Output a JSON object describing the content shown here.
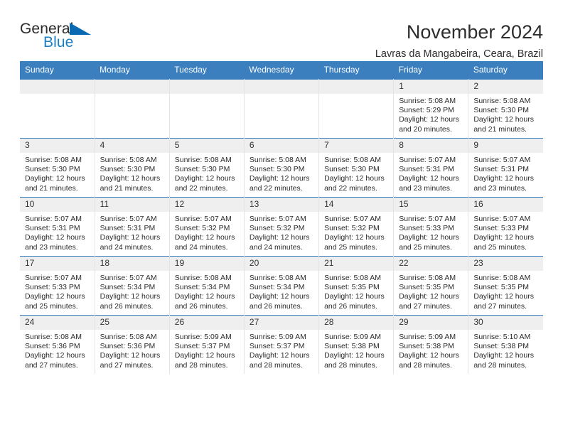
{
  "brand": {
    "name_part1": "General",
    "name_part2": "Blue",
    "accent_color": "#1b7fc4",
    "triangle_color": "#0a69b3"
  },
  "header": {
    "title": "November 2024",
    "subtitle": "Lavras da Mangabeira, Ceara, Brazil",
    "header_bg_color": "#3b7fbf",
    "daynum_bg_color": "#efefef"
  },
  "weekday_headers": [
    "Sunday",
    "Monday",
    "Tuesday",
    "Wednesday",
    "Thursday",
    "Friday",
    "Saturday"
  ],
  "labels": {
    "sunrise_prefix": "Sunrise:",
    "sunset_prefix": "Sunset:",
    "daylight_prefix": "Daylight:"
  },
  "weeks": [
    [
      {
        "day": "",
        "empty": true,
        "l1": "",
        "l2": "",
        "l3": "",
        "l4": ""
      },
      {
        "day": "",
        "empty": true,
        "l1": "",
        "l2": "",
        "l3": "",
        "l4": ""
      },
      {
        "day": "",
        "empty": true,
        "l1": "",
        "l2": "",
        "l3": "",
        "l4": ""
      },
      {
        "day": "",
        "empty": true,
        "l1": "",
        "l2": "",
        "l3": "",
        "l4": ""
      },
      {
        "day": "",
        "empty": true,
        "l1": "",
        "l2": "",
        "l3": "",
        "l4": ""
      },
      {
        "day": "1",
        "empty": false,
        "l1": "Sunrise: 5:08 AM",
        "l2": "Sunset: 5:29 PM",
        "l3": "Daylight: 12 hours",
        "l4": "and 20 minutes."
      },
      {
        "day": "2",
        "empty": false,
        "l1": "Sunrise: 5:08 AM",
        "l2": "Sunset: 5:30 PM",
        "l3": "Daylight: 12 hours",
        "l4": "and 21 minutes."
      }
    ],
    [
      {
        "day": "3",
        "empty": false,
        "l1": "Sunrise: 5:08 AM",
        "l2": "Sunset: 5:30 PM",
        "l3": "Daylight: 12 hours",
        "l4": "and 21 minutes."
      },
      {
        "day": "4",
        "empty": false,
        "l1": "Sunrise: 5:08 AM",
        "l2": "Sunset: 5:30 PM",
        "l3": "Daylight: 12 hours",
        "l4": "and 21 minutes."
      },
      {
        "day": "5",
        "empty": false,
        "l1": "Sunrise: 5:08 AM",
        "l2": "Sunset: 5:30 PM",
        "l3": "Daylight: 12 hours",
        "l4": "and 22 minutes."
      },
      {
        "day": "6",
        "empty": false,
        "l1": "Sunrise: 5:08 AM",
        "l2": "Sunset: 5:30 PM",
        "l3": "Daylight: 12 hours",
        "l4": "and 22 minutes."
      },
      {
        "day": "7",
        "empty": false,
        "l1": "Sunrise: 5:08 AM",
        "l2": "Sunset: 5:30 PM",
        "l3": "Daylight: 12 hours",
        "l4": "and 22 minutes."
      },
      {
        "day": "8",
        "empty": false,
        "l1": "Sunrise: 5:07 AM",
        "l2": "Sunset: 5:31 PM",
        "l3": "Daylight: 12 hours",
        "l4": "and 23 minutes."
      },
      {
        "day": "9",
        "empty": false,
        "l1": "Sunrise: 5:07 AM",
        "l2": "Sunset: 5:31 PM",
        "l3": "Daylight: 12 hours",
        "l4": "and 23 minutes."
      }
    ],
    [
      {
        "day": "10",
        "empty": false,
        "l1": "Sunrise: 5:07 AM",
        "l2": "Sunset: 5:31 PM",
        "l3": "Daylight: 12 hours",
        "l4": "and 23 minutes."
      },
      {
        "day": "11",
        "empty": false,
        "l1": "Sunrise: 5:07 AM",
        "l2": "Sunset: 5:31 PM",
        "l3": "Daylight: 12 hours",
        "l4": "and 24 minutes."
      },
      {
        "day": "12",
        "empty": false,
        "l1": "Sunrise: 5:07 AM",
        "l2": "Sunset: 5:32 PM",
        "l3": "Daylight: 12 hours",
        "l4": "and 24 minutes."
      },
      {
        "day": "13",
        "empty": false,
        "l1": "Sunrise: 5:07 AM",
        "l2": "Sunset: 5:32 PM",
        "l3": "Daylight: 12 hours",
        "l4": "and 24 minutes."
      },
      {
        "day": "14",
        "empty": false,
        "l1": "Sunrise: 5:07 AM",
        "l2": "Sunset: 5:32 PM",
        "l3": "Daylight: 12 hours",
        "l4": "and 25 minutes."
      },
      {
        "day": "15",
        "empty": false,
        "l1": "Sunrise: 5:07 AM",
        "l2": "Sunset: 5:33 PM",
        "l3": "Daylight: 12 hours",
        "l4": "and 25 minutes."
      },
      {
        "day": "16",
        "empty": false,
        "l1": "Sunrise: 5:07 AM",
        "l2": "Sunset: 5:33 PM",
        "l3": "Daylight: 12 hours",
        "l4": "and 25 minutes."
      }
    ],
    [
      {
        "day": "17",
        "empty": false,
        "l1": "Sunrise: 5:07 AM",
        "l2": "Sunset: 5:33 PM",
        "l3": "Daylight: 12 hours",
        "l4": "and 25 minutes."
      },
      {
        "day": "18",
        "empty": false,
        "l1": "Sunrise: 5:07 AM",
        "l2": "Sunset: 5:34 PM",
        "l3": "Daylight: 12 hours",
        "l4": "and 26 minutes."
      },
      {
        "day": "19",
        "empty": false,
        "l1": "Sunrise: 5:08 AM",
        "l2": "Sunset: 5:34 PM",
        "l3": "Daylight: 12 hours",
        "l4": "and 26 minutes."
      },
      {
        "day": "20",
        "empty": false,
        "l1": "Sunrise: 5:08 AM",
        "l2": "Sunset: 5:34 PM",
        "l3": "Daylight: 12 hours",
        "l4": "and 26 minutes."
      },
      {
        "day": "21",
        "empty": false,
        "l1": "Sunrise: 5:08 AM",
        "l2": "Sunset: 5:35 PM",
        "l3": "Daylight: 12 hours",
        "l4": "and 26 minutes."
      },
      {
        "day": "22",
        "empty": false,
        "l1": "Sunrise: 5:08 AM",
        "l2": "Sunset: 5:35 PM",
        "l3": "Daylight: 12 hours",
        "l4": "and 27 minutes."
      },
      {
        "day": "23",
        "empty": false,
        "l1": "Sunrise: 5:08 AM",
        "l2": "Sunset: 5:35 PM",
        "l3": "Daylight: 12 hours",
        "l4": "and 27 minutes."
      }
    ],
    [
      {
        "day": "24",
        "empty": false,
        "l1": "Sunrise: 5:08 AM",
        "l2": "Sunset: 5:36 PM",
        "l3": "Daylight: 12 hours",
        "l4": "and 27 minutes."
      },
      {
        "day": "25",
        "empty": false,
        "l1": "Sunrise: 5:08 AM",
        "l2": "Sunset: 5:36 PM",
        "l3": "Daylight: 12 hours",
        "l4": "and 27 minutes."
      },
      {
        "day": "26",
        "empty": false,
        "l1": "Sunrise: 5:09 AM",
        "l2": "Sunset: 5:37 PM",
        "l3": "Daylight: 12 hours",
        "l4": "and 28 minutes."
      },
      {
        "day": "27",
        "empty": false,
        "l1": "Sunrise: 5:09 AM",
        "l2": "Sunset: 5:37 PM",
        "l3": "Daylight: 12 hours",
        "l4": "and 28 minutes."
      },
      {
        "day": "28",
        "empty": false,
        "l1": "Sunrise: 5:09 AM",
        "l2": "Sunset: 5:38 PM",
        "l3": "Daylight: 12 hours",
        "l4": "and 28 minutes."
      },
      {
        "day": "29",
        "empty": false,
        "l1": "Sunrise: 5:09 AM",
        "l2": "Sunset: 5:38 PM",
        "l3": "Daylight: 12 hours",
        "l4": "and 28 minutes."
      },
      {
        "day": "30",
        "empty": false,
        "l1": "Sunrise: 5:10 AM",
        "l2": "Sunset: 5:38 PM",
        "l3": "Daylight: 12 hours",
        "l4": "and 28 minutes."
      }
    ]
  ]
}
